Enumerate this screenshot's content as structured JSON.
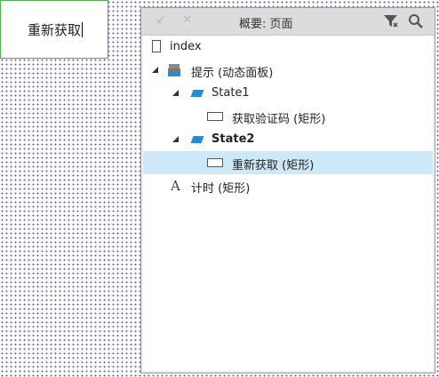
{
  "canvas": {
    "widget_text": "重新获取"
  },
  "panel": {
    "title": "概要: 页面",
    "icons": {
      "back": "arrow-back-icon",
      "close": "close-icon",
      "filter": "filter-icon",
      "search": "search-icon"
    },
    "rows": [
      {
        "label": "index",
        "icon": "page-icon",
        "bold": false,
        "selected": false
      },
      {
        "label": "提示 (动态面板)",
        "icon": "dynamic-panel-icon",
        "bold": false,
        "selected": false,
        "expanded": true
      },
      {
        "label": "State1",
        "icon": "state-icon",
        "bold": false,
        "selected": false,
        "expanded": true
      },
      {
        "label": "获取验证码 (矩形)",
        "icon": "rectangle-icon",
        "bold": false,
        "selected": false
      },
      {
        "label": "State2",
        "icon": "state-icon",
        "bold": true,
        "selected": false,
        "expanded": true
      },
      {
        "label": "重新获取 (矩形)",
        "icon": "rectangle-icon",
        "bold": false,
        "selected": true
      },
      {
        "label": "计时 (矩形)",
        "icon": "text-icon",
        "bold": false,
        "selected": false
      }
    ]
  },
  "colors": {
    "selection": "#cde8f6",
    "state_icon": "#1e8fd8",
    "widget_border": "#4fb34f",
    "grid_dots": "#5b5bd6"
  }
}
